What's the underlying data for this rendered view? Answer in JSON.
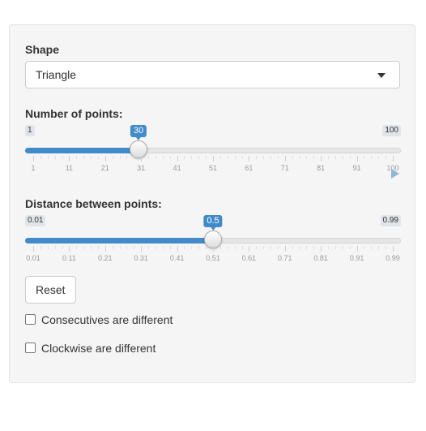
{
  "shape": {
    "label": "Shape",
    "selected": "Triangle"
  },
  "num_points": {
    "label": "Number of points:",
    "min": 1,
    "max": 100,
    "value": 30,
    "min_text": "1",
    "max_text": "100",
    "value_text": "30",
    "ticks": [
      "1",
      "11",
      "21",
      "31",
      "41",
      "51",
      "61",
      "71",
      "81",
      "91",
      "100"
    ]
  },
  "distance": {
    "label": "Distance between points:",
    "min": 0.01,
    "max": 0.99,
    "value": 0.5,
    "min_text": "0.01",
    "max_text": "0.99",
    "value_text": "0.5",
    "ticks": [
      "0.01",
      "0.11",
      "0.21",
      "0.31",
      "0.41",
      "0.51",
      "0.61",
      "0.71",
      "0.81",
      "0.91",
      "0.99"
    ]
  },
  "reset_label": "Reset",
  "checkboxes": [
    {
      "label": "Consecutives are different",
      "checked": false
    },
    {
      "label": "Clockwise are different",
      "checked": false
    }
  ],
  "colors": {
    "accent": "#428bca",
    "play_icon": "#8fb6dd"
  },
  "icons": {
    "select_caret": "caret-down-icon",
    "animate": "play-icon"
  }
}
